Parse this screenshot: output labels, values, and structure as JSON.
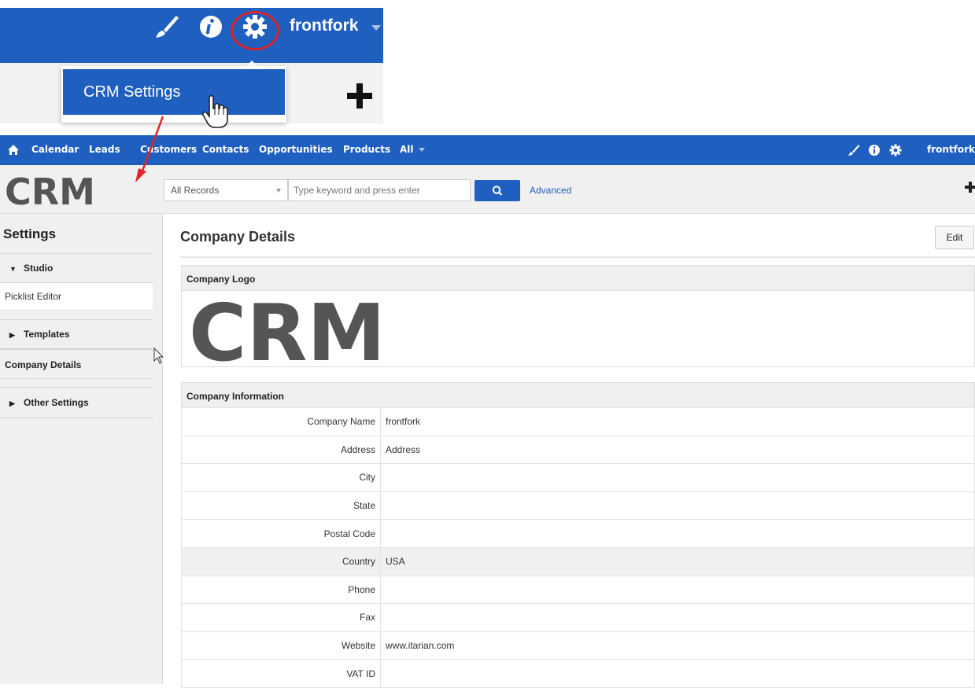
{
  "zoom": {
    "username": "frontfork",
    "menu_item": "CRM Settings"
  },
  "nav": {
    "items": [
      "Calendar",
      "Leads",
      "Customers",
      "Contacts",
      "Opportunities",
      "Products",
      "All"
    ],
    "username": "frontfork"
  },
  "brand": {
    "logo_text": "CRM"
  },
  "search": {
    "scope": "All Records",
    "placeholder": "Type keyword and press enter",
    "advanced_label": "Advanced"
  },
  "sidebar": {
    "title": "Settings",
    "studio_label": "Studio",
    "studio_items": [
      "Picklist Editor"
    ],
    "templates_label": "Templates",
    "company_details_label": "Company Details",
    "other_settings_label": "Other Settings"
  },
  "main": {
    "title": "Company Details",
    "edit_label": "Edit",
    "logo_panel_title": "Company Logo",
    "logo_text": "CRM",
    "info_panel_title": "Company Information",
    "fields": [
      {
        "label": "Company Name",
        "value": "frontfork"
      },
      {
        "label": "Address",
        "value": "Address"
      },
      {
        "label": "City",
        "value": ""
      },
      {
        "label": "State",
        "value": ""
      },
      {
        "label": "Postal Code",
        "value": ""
      },
      {
        "label": "Country",
        "value": "USA"
      },
      {
        "label": "Phone",
        "value": ""
      },
      {
        "label": "Fax",
        "value": ""
      },
      {
        "label": "Website",
        "value": "www.itarian.com"
      },
      {
        "label": "VAT ID",
        "value": ""
      }
    ]
  },
  "colors": {
    "brand_blue": "#1f5fbf",
    "highlight_red": "#d9262a",
    "logo_gray": "#555555"
  }
}
